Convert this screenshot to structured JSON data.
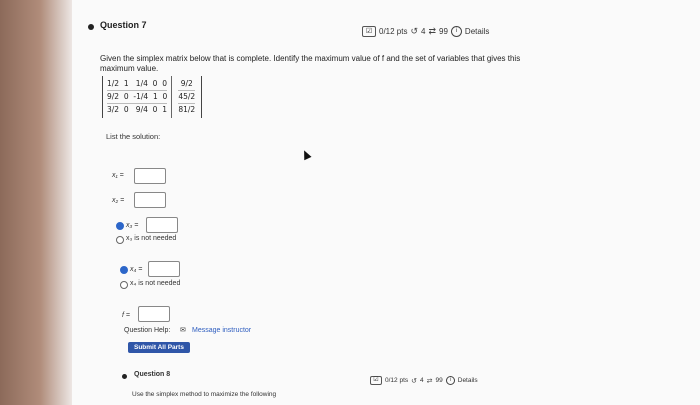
{
  "question7": {
    "title": "Question 7",
    "meta": {
      "points": "0/12 pts",
      "retries": "4",
      "attempts": "99",
      "details": "Details"
    },
    "prompt": "Given the simplex matrix below that is complete. Identify the maximum value of f and the set of variables that gives this maximum value.",
    "matrix": {
      "rows": [
        [
          "1/2",
          "1",
          "1/4",
          "0",
          "0"
        ],
        [
          "9/2",
          "0",
          "-1/4",
          "1",
          "0"
        ],
        [
          "3/2",
          "0",
          "9/4",
          "0",
          "1"
        ]
      ],
      "rhs": [
        "9/2",
        "45/2",
        "81/2"
      ]
    },
    "list_label": "List the solution:",
    "vars": {
      "x1": "x₁ =",
      "x2": "x₂ =",
      "x3": "x₃ =",
      "x3_not_needed": "x₃ is not needed",
      "x4": "x₄ =",
      "x4_not_needed": "x₄ is not needed",
      "f": "f ="
    },
    "help_label": "Question Help:",
    "message_link": "Message instructor",
    "submit": "Submit All Parts"
  },
  "question8": {
    "title": "Question 8",
    "meta": {
      "points": "0/12 pts",
      "retries": "4",
      "attempts": "99",
      "details": "Details"
    },
    "prompt": "Use the simplex method to maximize the following"
  }
}
